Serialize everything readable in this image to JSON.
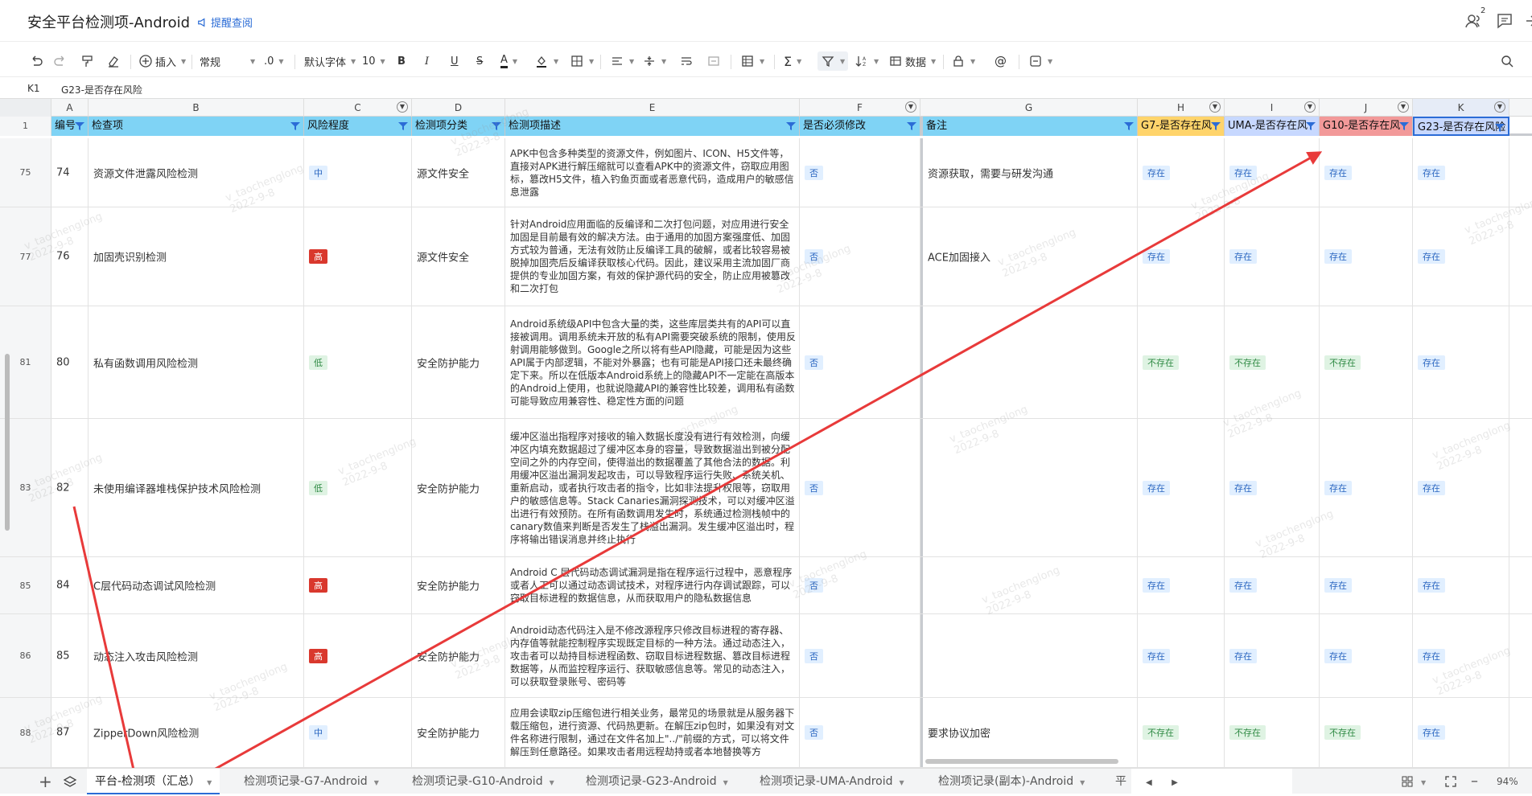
{
  "title": "安全平台检测项-Android",
  "remind": "提醒查阅",
  "notify_count": "2",
  "toolbar": {
    "insert": "插入",
    "format": "常规",
    "decimals": ".0",
    "font": "默认字体",
    "size": "10",
    "data": "数据"
  },
  "formula": {
    "ref": "K1",
    "value": "G23-是否存在风险"
  },
  "columns": [
    "A",
    "B",
    "C",
    "D",
    "E",
    "F",
    "G",
    "H",
    "I",
    "J",
    "K"
  ],
  "headers": {
    "a": "编号",
    "b": "检查项",
    "c": "风险程度",
    "d": "检测项分类",
    "e": "检测项描述",
    "f": "是否必须修改",
    "g": "备注",
    "h": "G7-是否存在风",
    "i": "UMA-是否存在风",
    "j": "G10-是否存在风",
    "k": "G23-是否存在风险"
  },
  "header_row_num": "1",
  "rows": [
    {
      "rn": "75",
      "id": "74",
      "item": "资源文件泄露风险检测",
      "level": "中",
      "cat": "源文件安全",
      "desc": "APK中包含多种类型的资源文件，例如图片、ICON、H5文件等，直接对APK进行解压缩就可以查看APK中的资源文件，窃取应用图标，篡改H5文件，植入钓鱼页面或者恶意代码，造成用户的敏感信息泄露",
      "must": "否",
      "note": "资源获取，需要与研发沟通",
      "g7": "存在",
      "uma": "存在",
      "g10": "存在",
      "g23": "存在"
    },
    {
      "rn": "77",
      "id": "76",
      "item": "加固壳识别检测",
      "level": "高",
      "cat": "源文件安全",
      "desc": "针对Android应用面临的反编译和二次打包问题，对应用进行安全加固是目前最有效的解决方法。由于通用的加固方案强度低、加固方式较为普通，无法有效防止反编译工具的破解，或者比较容易被脱掉加固壳后反编译获取核心代码。因此，建议采用主流加固厂商提供的专业加固方案，有效的保护源代码的安全，防止应用被篡改和二次打包",
      "must": "否",
      "note": "ACE加固接入",
      "g7": "存在",
      "uma": "存在",
      "g10": "存在",
      "g23": "存在"
    },
    {
      "rn": "81",
      "id": "80",
      "item": "私有函数调用风险检测",
      "level": "低",
      "cat": "安全防护能力",
      "desc": "Android系统级API中包含大量的类，这些库层类共有的API可以直接被调用。调用系统未开放的私有API需要突破系统的限制，使用反射调用能够做到。Google之所以将有些API隐藏，可能是因为这些API属于内部逻辑，不能对外暴露；也有可能是API接口还未最终确定下来。所以在低版本Android系统上的隐藏API不一定能在高版本的Android上使用，也就说隐藏API的兼容性比较差，调用私有函数可能导致应用兼容性、稳定性方面的问题",
      "must": "否",
      "note": "",
      "g7": "不存在",
      "uma": "不存在",
      "g10": "不存在",
      "g23": "存在"
    },
    {
      "rn": "83",
      "id": "82",
      "item": "未使用编译器堆栈保护技术风险检测",
      "level": "低",
      "cat": "安全防护能力",
      "desc": "缓冲区溢出指程序对接收的输入数据长度没有进行有效检测，向缓冲区内填充数据超过了缓冲区本身的容量，导致数据溢出到被分配空间之外的内存空间，使得溢出的数据覆盖了其他合法的数据。利用缓冲区溢出漏洞发起攻击，可以导致程序运行失败、系统关机、重新启动，或者执行攻击者的指令，比如非法提升权限等，窃取用户的敏感信息等。Stack Canaries漏洞探测技术，可以对缓冲区溢出进行有效预防。在所有函数调用发生时，系统通过检测栈帧中的canary数值来判断是否发生了栈溢出漏洞。发生缓冲区溢出时，程序将输出错误消息并终止执行",
      "must": "否",
      "note": "",
      "g7": "存在",
      "uma": "存在",
      "g10": "存在",
      "g23": "存在"
    },
    {
      "rn": "85",
      "id": "84",
      "item": "C层代码动态调试风险检测",
      "level": "高",
      "cat": "安全防护能力",
      "desc": "Android C 层代码动态调试漏洞是指在程序运行过程中，恶意程序或者人工可以通过动态调试技术，对程序进行内存调试跟踪，可以窃取目标进程的数据信息，从而获取用户的隐私数据信息",
      "must": "否",
      "note": "",
      "g7": "存在",
      "uma": "存在",
      "g10": "存在",
      "g23": "存在"
    },
    {
      "rn": "86",
      "id": "85",
      "item": "动态注入攻击风险检测",
      "level": "高",
      "cat": "安全防护能力",
      "desc": "Android动态代码注入是不修改源程序只修改目标进程的寄存器、内存值等就能控制程序实现既定目标的一种方法。通过动态注入，攻击者可以劫持目标进程函数、窃取目标进程数据、篡改目标进程数据等，从而监控程序运行、获取敏感信息等。常见的动态注入，可以获取登录账号、密码等",
      "must": "否",
      "note": "",
      "g7": "存在",
      "uma": "存在",
      "g10": "存在",
      "g23": "存在"
    },
    {
      "rn": "88",
      "id": "87",
      "item": "ZipperDown风险检测",
      "level": "中",
      "cat": "安全防护能力",
      "desc": "应用会读取zip压缩包进行相关业务，最常见的场景就是从服务器下载压缩包，进行资源、代码热更新。在解压zip包时，如果没有对文件名称进行限制，通过在文件名加上\"../\"前缀的方式，可以将文件解压到任意路径。如果攻击者用远程劫持或者本地替换等方",
      "must": "否",
      "note": "要求协议加密",
      "g7": "不存在",
      "uma": "不存在",
      "g10": "不存在",
      "g23": "存在"
    }
  ],
  "sheet_tabs": [
    "平台-检测项（汇总）",
    "检测项记录-G7-Android",
    "检测项记录-G10-Android",
    "检测项记录-G23-Android",
    "检测项记录-UMA-Android",
    "检测项记录(副本)-Android",
    "平"
  ],
  "zoom": "94%",
  "watermark_name": "v_taochenglong",
  "watermark_date": "2022-9-8",
  "colors": {
    "header_blue": "#7fd3f5",
    "g7": "#ffd46b",
    "uma": "#c7d8ff",
    "g10": "#f29999",
    "g23": "#c7d8ff",
    "high": "#d9382d",
    "arrow": "#e83a3a"
  }
}
